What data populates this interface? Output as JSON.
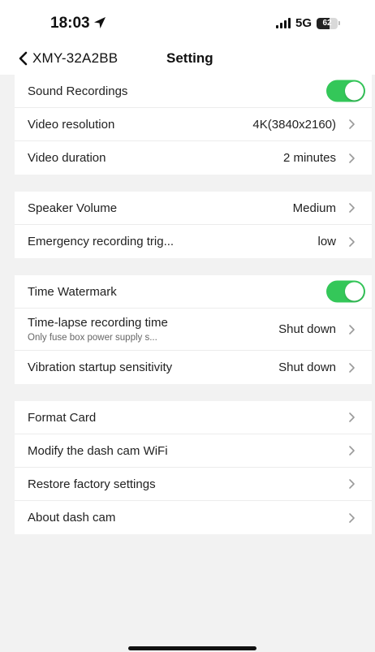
{
  "status_bar": {
    "time": "18:03",
    "network": "5G",
    "battery": "62",
    "battery_level": 0.62
  },
  "nav": {
    "back_label": "XMY-32A2BB",
    "title": "Setting"
  },
  "groups": [
    {
      "rows": [
        {
          "label": "Sound Recordings",
          "type": "toggle",
          "on": true
        },
        {
          "label": "Video resolution",
          "value": "4K(3840x2160)",
          "type": "chevron"
        },
        {
          "label": "Video duration",
          "value": "2 minutes",
          "type": "chevron"
        }
      ]
    },
    {
      "rows": [
        {
          "label": "Speaker Volume",
          "value": "Medium",
          "type": "chevron"
        },
        {
          "label": "Emergency recording trig...",
          "value": "low",
          "type": "chevron"
        }
      ]
    },
    {
      "rows": [
        {
          "label": "Time Watermark",
          "type": "toggle",
          "on": true
        },
        {
          "label": "Time-lapse recording time",
          "sublabel": "Only fuse box power supply s...",
          "value": "Shut down",
          "type": "chevron"
        },
        {
          "label": "Vibration startup sensitivity",
          "value": "Shut down",
          "type": "chevron"
        }
      ]
    },
    {
      "rows": [
        {
          "label": "Format Card",
          "type": "chevron"
        },
        {
          "label": "Modify the dash cam WiFi",
          "type": "chevron"
        },
        {
          "label": "Restore factory settings",
          "type": "chevron"
        },
        {
          "label": "About dash cam",
          "type": "chevron"
        }
      ]
    }
  ],
  "colors": {
    "toggle_on": "#34c759",
    "background": "#f2f2f2",
    "chevron": "#9a9a9a"
  }
}
